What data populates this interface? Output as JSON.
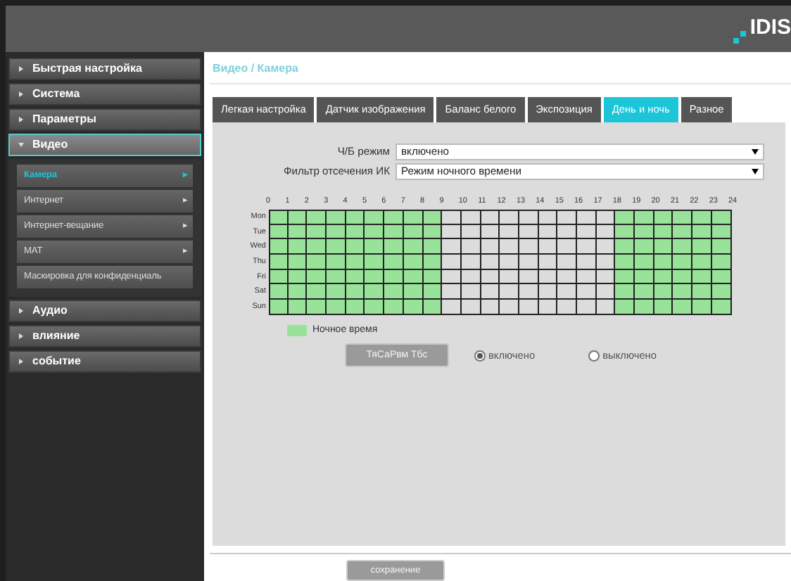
{
  "header": {
    "logo": "IDIS"
  },
  "sidebar": {
    "items": [
      {
        "label": "Быстрая настройка",
        "expanded": false
      },
      {
        "label": "Система",
        "expanded": false
      },
      {
        "label": "Параметры",
        "expanded": false
      },
      {
        "label": "Видео",
        "expanded": true,
        "children": [
          {
            "label": "Камера",
            "selected": true,
            "arrow": "▸"
          },
          {
            "label": "Интернет",
            "selected": false,
            "arrow": "▸"
          },
          {
            "label": "Интернет-вещание",
            "selected": false,
            "arrow": "▸"
          },
          {
            "label": "MAT",
            "selected": false,
            "arrow": "▸"
          },
          {
            "label": "Маскировка для конфиденциаль",
            "selected": false
          }
        ]
      },
      {
        "label": "Аудио",
        "expanded": false
      },
      {
        "label": "влияние",
        "expanded": false
      },
      {
        "label": "событие",
        "expanded": false
      }
    ]
  },
  "breadcrumb": "Видео / Камера",
  "tabs": [
    {
      "label": "Легкая настройка",
      "selected": false
    },
    {
      "label": "Датчик изображения",
      "selected": false
    },
    {
      "label": "Баланс белого",
      "selected": false
    },
    {
      "label": "Экспозиция",
      "selected": false
    },
    {
      "label": "День и ночь",
      "selected": true
    },
    {
      "label": "Разное",
      "selected": false
    }
  ],
  "fields": [
    {
      "label": "Ч/Б режим",
      "value": "включено"
    },
    {
      "label": "Фильтр отсечения ИК",
      "value": "Режим ночного времени"
    }
  ],
  "schedule": {
    "hours": [
      "0",
      "1",
      "2",
      "3",
      "4",
      "5",
      "6",
      "7",
      "8",
      "9",
      "10",
      "11",
      "12",
      "13",
      "14",
      "15",
      "16",
      "17",
      "18",
      "19",
      "20",
      "21",
      "22",
      "23",
      "24"
    ],
    "rows": [
      {
        "day": "Mon",
        "night": [
          true,
          true,
          true,
          true,
          true,
          true,
          true,
          true,
          true,
          false,
          false,
          false,
          false,
          false,
          false,
          false,
          false,
          false,
          true,
          true,
          true,
          true,
          true,
          true
        ]
      },
      {
        "day": "Tue",
        "night": [
          true,
          true,
          true,
          true,
          true,
          true,
          true,
          true,
          true,
          false,
          false,
          false,
          false,
          false,
          false,
          false,
          false,
          false,
          true,
          true,
          true,
          true,
          true,
          true
        ]
      },
      {
        "day": "Wed",
        "night": [
          true,
          true,
          true,
          true,
          true,
          true,
          true,
          true,
          true,
          false,
          false,
          false,
          false,
          false,
          false,
          false,
          false,
          false,
          true,
          true,
          true,
          true,
          true,
          true
        ]
      },
      {
        "day": "Thu",
        "night": [
          true,
          true,
          true,
          true,
          true,
          true,
          true,
          true,
          true,
          false,
          false,
          false,
          false,
          false,
          false,
          false,
          false,
          false,
          true,
          true,
          true,
          true,
          true,
          true
        ]
      },
      {
        "day": "Fri",
        "night": [
          true,
          true,
          true,
          true,
          true,
          true,
          true,
          true,
          true,
          false,
          false,
          false,
          false,
          false,
          false,
          false,
          false,
          false,
          true,
          true,
          true,
          true,
          true,
          true
        ]
      },
      {
        "day": "Sat",
        "night": [
          true,
          true,
          true,
          true,
          true,
          true,
          true,
          true,
          true,
          false,
          false,
          false,
          false,
          false,
          false,
          false,
          false,
          false,
          true,
          true,
          true,
          true,
          true,
          true
        ]
      },
      {
        "day": "Sun",
        "night": [
          true,
          true,
          true,
          true,
          true,
          true,
          true,
          true,
          true,
          false,
          false,
          false,
          false,
          false,
          false,
          false,
          false,
          false,
          true,
          true,
          true,
          true,
          true,
          true
        ]
      }
    ],
    "legend": "Ночное время"
  },
  "mode_button": {
    "label": "ТяСаРвм Тбс",
    "disabled": true
  },
  "radios": [
    {
      "label": "включено",
      "selected": true
    },
    {
      "label": "выключено",
      "selected": false
    }
  ],
  "save_button": {
    "label": "сохранение",
    "disabled": true
  }
}
